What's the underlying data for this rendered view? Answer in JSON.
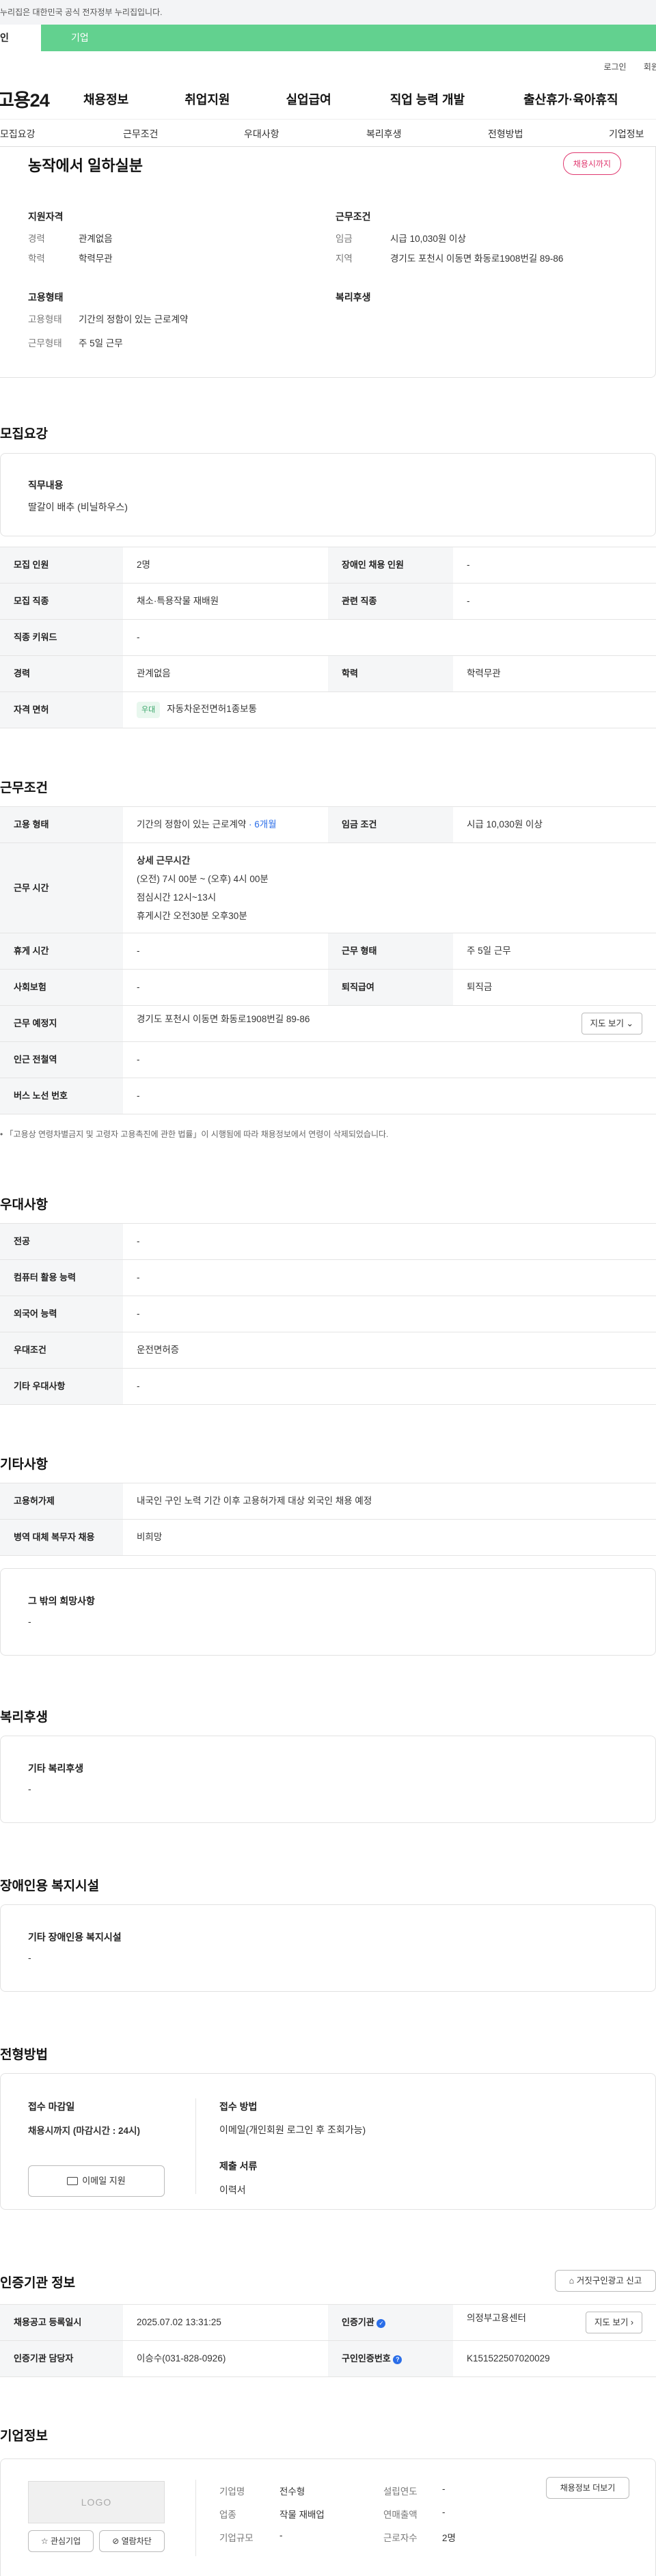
{
  "gov_banner": "누리집은 대한민국 공식 전자정부 누리집입니다.",
  "tabs": [
    "인",
    "기업"
  ],
  "util": [
    "로그인",
    "회원"
  ],
  "logo": "고용24",
  "gnb": [
    "채용정보",
    "취업지원",
    "실업급여",
    "직업 능력 개발",
    "출산휴가·육아휴직"
  ],
  "snb": [
    "모집요강",
    "근무조건",
    "우대사항",
    "복리후생",
    "전형방법",
    "기업정보"
  ],
  "summary": {
    "title": "농작에서 일하실분",
    "deadline_pill": "채용시까지",
    "qual_h": "지원자격",
    "cond_h": "근무조건",
    "emp_h": "고용형태",
    "welfare_h": "복리후생",
    "qual": [
      {
        "k": "경력",
        "v": "관계없음"
      },
      {
        "k": "학력",
        "v": "학력무관"
      }
    ],
    "cond": [
      {
        "k": "임금",
        "v": "시급 10,030원 이상"
      },
      {
        "k": "지역",
        "v": "경기도 포천시 이동면 화동로1908번길 89-86"
      }
    ],
    "emp": [
      {
        "k": "고용형태",
        "v": "기간의 정함이 있는 근로계약"
      },
      {
        "k": "근무형태",
        "v": "주 5일 근무"
      }
    ]
  },
  "recruit": {
    "heading": "모집요강",
    "duty_label": "직무내용",
    "duty_value": "딸갈이 배추 (비닐하우스)",
    "rows": [
      {
        "k1": "모집 인원",
        "v1": "2명",
        "k2": "장애인 채용 인원",
        "v2": "-"
      },
      {
        "k1": "모집 직종",
        "v1": "채소·특용작물 재배원",
        "k2": "관련 직종",
        "v2": "-"
      },
      {
        "k1": "직종 키워드",
        "v1": "-"
      },
      {
        "k1": "경력",
        "v1": "관계없음",
        "k2": "학력",
        "v2": "학력무관"
      }
    ],
    "license_k": "자격 면허",
    "license_badge": "우대",
    "license_v": "자동차운전면허1종보통"
  },
  "work": {
    "heading": "근무조건",
    "type_k": "고용 형태",
    "type_v": "기간의 정함이 있는 근로계약",
    "type_dur": " · 6개월",
    "wage_k": "임금 조건",
    "wage_v": "시급 10,030원 이상",
    "hours_k": "근무 시간",
    "hours_lines": [
      "상세 근무시간",
      "(오전) 7시 00분 ~ (오후) 4시 00분",
      "점심시간 12시~13시",
      "휴게시간 오전30분 오후30분"
    ],
    "break_k": "휴게 시간",
    "break_v": "-",
    "form_k": "근무 형태",
    "form_v": "주 5일 근무",
    "ins_k": "사회보험",
    "ins_v": "-",
    "sev_k": "퇴직급여",
    "sev_v": "퇴직금",
    "place_k": "근무 예정지",
    "place_v": "경기도 포천시 이동면 화동로1908번길 89-86",
    "map_btn": "지도 보기",
    "subway_k": "인근 전철역",
    "subway_v": "-",
    "bus_k": "버스 노선 번호",
    "bus_v": "-",
    "note": "「고용상 연령차별금지 및 고령자 고용촉진에 관한 법률」이 시행됨에 따라 채용정보에서 연령이 삭제되었습니다."
  },
  "pref": {
    "heading": "우대사항",
    "rows": [
      {
        "k": "전공",
        "v": "-"
      },
      {
        "k": "컴퓨터 활용 능력",
        "v": "-"
      },
      {
        "k": "외국어 능력",
        "v": "-"
      },
      {
        "k": "우대조건",
        "v": "운전면허증"
      },
      {
        "k": "기타 우대사항",
        "v": "-"
      }
    ]
  },
  "etc": {
    "heading": "기타사항",
    "rows": [
      {
        "k": "고용허가제",
        "v": "내국인 구인 노력 기간 이후 고용허가제 대상 외국인 채용 예정"
      },
      {
        "k": "병역 대체 복무자 채용",
        "v": "비희망"
      }
    ],
    "box_t": "그 밖의 희망사항",
    "box_v": "-"
  },
  "welfare": {
    "heading": "복리후생",
    "box_t": "기타 복리후생",
    "box_v": "-"
  },
  "disability": {
    "heading": "장애인용 복지시설",
    "box_t": "기타 장애인용 복지시설",
    "box_v": "-"
  },
  "selection": {
    "heading": "전형방법",
    "deadline_t": "접수 마감일",
    "deadline_v": "채용시까지 (마감시간 : 24시)",
    "email_btn": "이메일 지원",
    "method_t": "접수 방법",
    "method_v": "이메일(개인회원 로그인 후 조회가능)",
    "docs_t": "제출 서류",
    "docs_v": "이력서"
  },
  "cert": {
    "heading": "인증기관 정보",
    "report_btn": "거짓구인광고 신고",
    "reg_k": "채용공고 등록일시",
    "reg_v": "2025.07.02 13:31:25",
    "org_k": "인증기관",
    "org_v": "의정부고용센터",
    "map_btn": "지도 보기",
    "mgr_k": "인증기관 담당자",
    "mgr_v": "이승수(031-828-0926)",
    "num_k": "구인인증번호",
    "num_v": "K151522507020029"
  },
  "company": {
    "heading": "기업정보",
    "logo": "LOGO",
    "fav_btn": "관심기업",
    "block_btn": "열람차단",
    "more_btn": "채용정보 더보기",
    "name_k": "기업명",
    "name_v": "전수형",
    "est_k": "설립연도",
    "est_v": "-",
    "ind_k": "업종",
    "ind_v": "작물 재배업",
    "sales_k": "연매출액",
    "sales_v": "-",
    "size_k": "기업규모",
    "size_v": "-",
    "emp_k": "근로자수",
    "emp_v": "2명"
  },
  "colors": {
    "accent": "#62d18f",
    "red": "#e0386f",
    "blue": "#2b6ee8"
  }
}
